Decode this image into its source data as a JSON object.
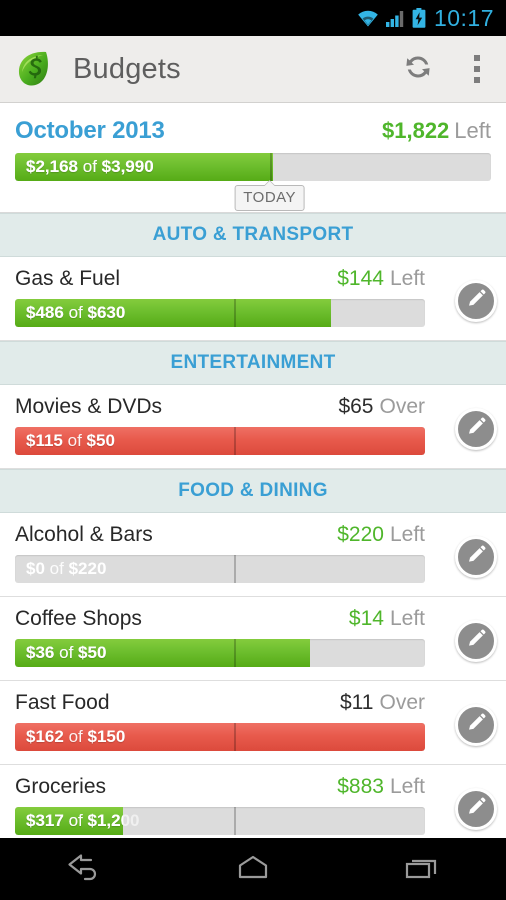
{
  "status_bar": {
    "time": "10:17",
    "icons": [
      "wifi-icon",
      "cellular-signal-icon",
      "battery-charging-icon"
    ],
    "accent_color": "#31b0e0"
  },
  "action_bar": {
    "logo_icon": "mint-leaf-logo",
    "title": "Budgets",
    "refresh_label": "refresh-icon",
    "overflow_label": "overflow-menu-icon"
  },
  "summary": {
    "month": "October 2013",
    "amount": "$1,822",
    "amount_label": "Left",
    "bar_text_spent": "$2,168",
    "bar_text_of": "of",
    "bar_text_total": "$3,990",
    "fill_percent": 54.3,
    "tick_percent": 53.5,
    "today_label": "TODAY",
    "state": "left"
  },
  "sections": [
    {
      "title": "AUTO & TRANSPORT",
      "rows": [
        {
          "category": "Gas & Fuel",
          "amount": "$144",
          "amount_label": "Left",
          "spent": "$486",
          "of": "of",
          "total": "$630",
          "fill_percent": 77.1,
          "tick_percent": 53.5,
          "state": "left",
          "edit_icon": "pencil-icon"
        }
      ]
    },
    {
      "title": "ENTERTAINMENT",
      "rows": [
        {
          "category": "Movies & DVDs",
          "amount": "$65",
          "amount_label": "Over",
          "spent": "$115",
          "of": "of",
          "total": "$50",
          "fill_percent": 100,
          "tick_percent": 53.5,
          "state": "over",
          "edit_icon": "pencil-icon"
        }
      ]
    },
    {
      "title": "FOOD & DINING",
      "rows": [
        {
          "category": "Alcohol & Bars",
          "amount": "$220",
          "amount_label": "Left",
          "spent": "$0",
          "of": "of",
          "total": "$220",
          "fill_percent": 0,
          "tick_percent": 53.5,
          "state": "left",
          "edit_icon": "pencil-icon"
        },
        {
          "category": "Coffee Shops",
          "amount": "$14",
          "amount_label": "Left",
          "spent": "$36",
          "of": "of",
          "total": "$50",
          "fill_percent": 72,
          "tick_percent": 53.5,
          "state": "left",
          "edit_icon": "pencil-icon"
        },
        {
          "category": "Fast Food",
          "amount": "$11",
          "amount_label": "Over",
          "spent": "$162",
          "of": "of",
          "total": "$150",
          "fill_percent": 100,
          "tick_percent": 53.5,
          "state": "over",
          "edit_icon": "pencil-icon"
        },
        {
          "category": "Groceries",
          "amount": "$883",
          "amount_label": "Left",
          "spent": "$317",
          "of": "of",
          "total": "$1,200",
          "fill_percent": 26.4,
          "tick_percent": 53.5,
          "state": "left",
          "edit_icon": "pencil-icon"
        }
      ]
    }
  ],
  "nav_bar": {
    "buttons": [
      "back-icon",
      "home-icon",
      "recents-icon"
    ]
  }
}
